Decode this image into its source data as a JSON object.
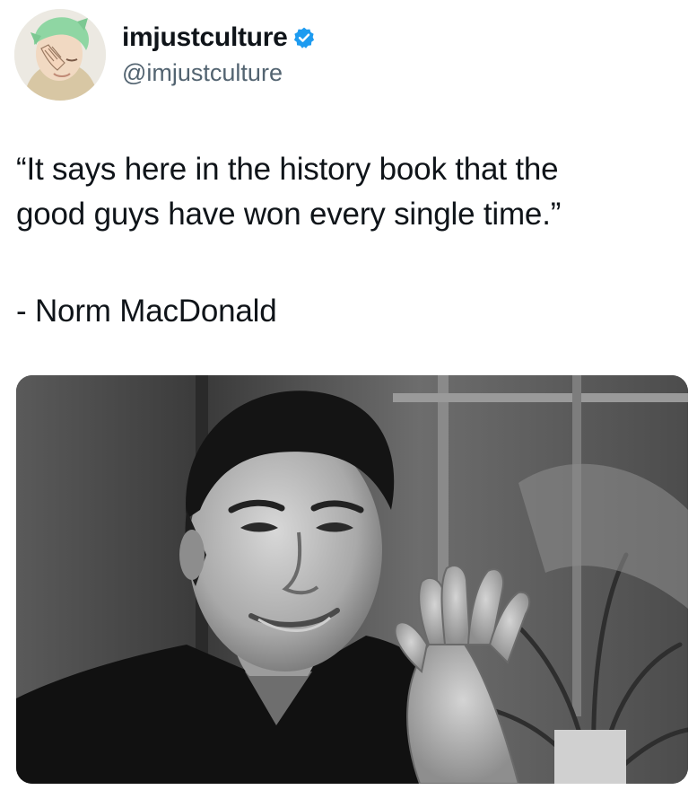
{
  "tweet": {
    "author": {
      "display_name": "imjustculture",
      "handle": "@imjustculture",
      "verified": true,
      "verified_icon": "verified-badge-icon",
      "avatar_icon": "anime-avatar"
    },
    "quote": "“It says here in the history book that the\ngood guys have won every single time.”",
    "attribution": "- Norm MacDonald",
    "media": {
      "type": "photo",
      "style": "black-and-white"
    }
  },
  "colors": {
    "verified_blue": "#1d9bf0",
    "text": "#0f1419",
    "secondary": "#536471"
  }
}
